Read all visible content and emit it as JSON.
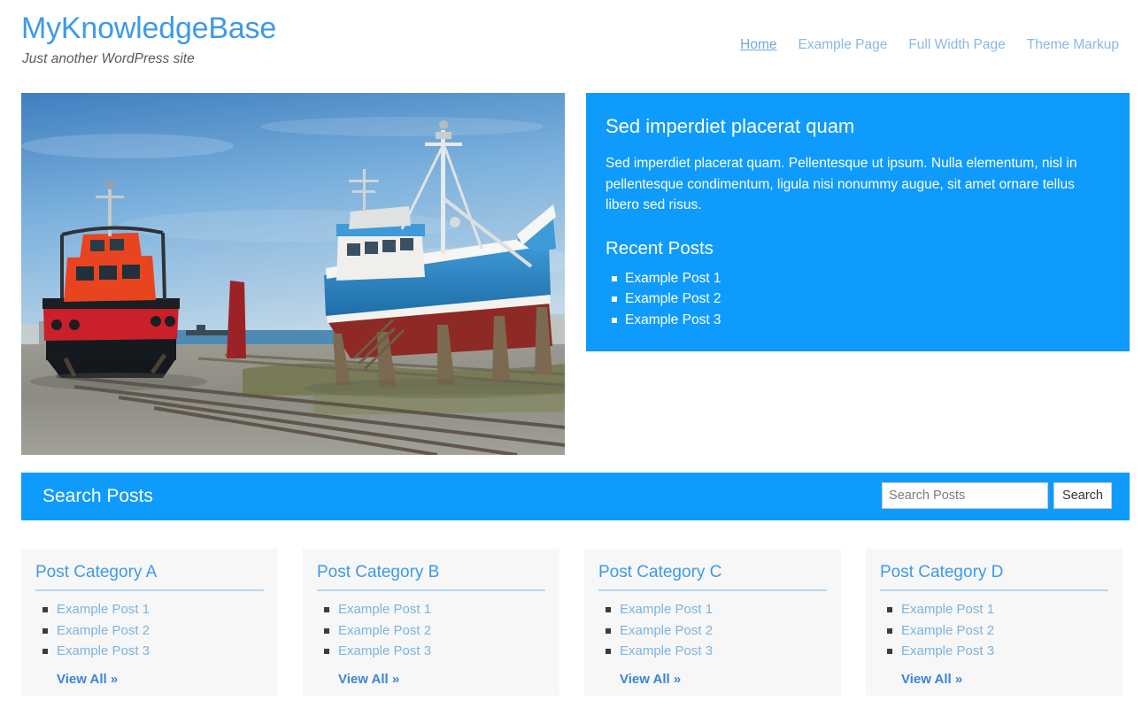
{
  "header": {
    "site_title": "MyKnowledgeBase",
    "site_description": "Just another WordPress site",
    "nav": [
      {
        "label": "Home",
        "active": true
      },
      {
        "label": "Example Page",
        "active": false
      },
      {
        "label": "Full Width Page",
        "active": false
      },
      {
        "label": "Theme Markup",
        "active": false
      }
    ]
  },
  "hero": {
    "image_alt": "Shipyard with a red tugboat and a blue and red fishing trawler in dry dock under a blue sky",
    "featured": {
      "title": "Sed imperdiet placerat quam",
      "body": "Sed imperdiet placerat quam. Pellentesque ut ipsum. Nulla elementum, nisl in pellentesque condimentum, ligula nisi nonummy augue, sit amet ornare tellus libero sed risus.",
      "recent_heading": "Recent Posts",
      "recent_posts": [
        "Example Post 1",
        "Example Post 2",
        "Example Post 3"
      ]
    }
  },
  "search": {
    "title": "Search Posts",
    "placeholder": "Search Posts",
    "value": "",
    "button_label": "Search"
  },
  "categories": [
    {
      "title": "Post Category A",
      "posts": [
        "Example Post 1",
        "Example Post 2",
        "Example Post 3"
      ],
      "view_all": "View All »"
    },
    {
      "title": "Post Category B",
      "posts": [
        "Example Post 1",
        "Example Post 2",
        "Example Post 3"
      ],
      "view_all": "View All »"
    },
    {
      "title": "Post Category C",
      "posts": [
        "Example Post 1",
        "Example Post 2",
        "Example Post 3"
      ],
      "view_all": "View All »"
    },
    {
      "title": "Post Category D",
      "posts": [
        "Example Post 1",
        "Example Post 2",
        "Example Post 3"
      ],
      "view_all": "View All »"
    }
  ],
  "colors": {
    "accent_blue": "#0f9bfc",
    "title_blue": "#3d9ae8",
    "link_blue": "#7ab4e2",
    "nav_blue": "#86b9e6",
    "box_bg": "#f7f7f7",
    "page_bg": "#ffffff"
  }
}
